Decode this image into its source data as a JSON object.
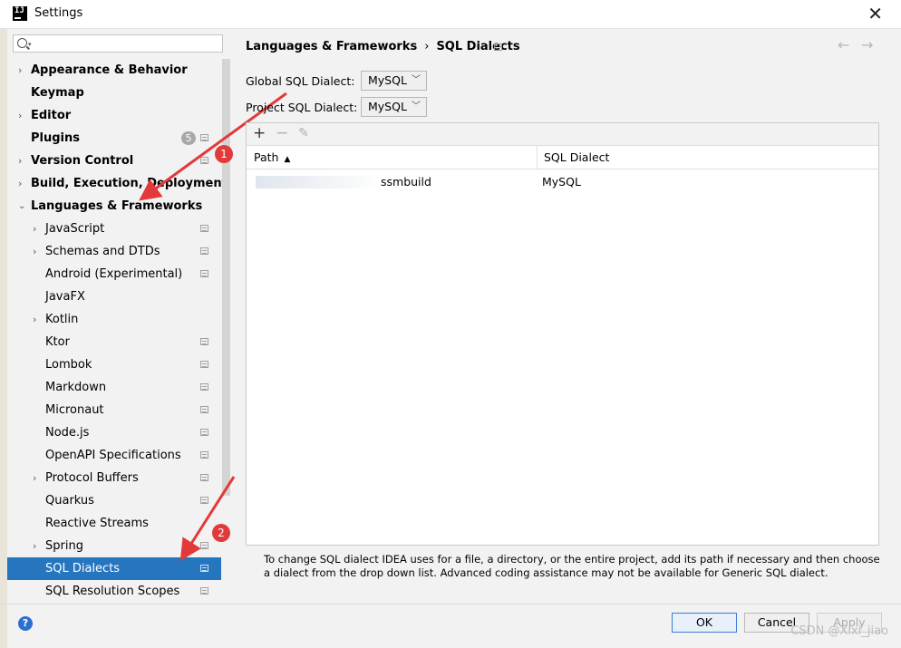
{
  "window": {
    "title": "Settings",
    "app_icon_text": "IJ",
    "close_glyph": "✕"
  },
  "search": {
    "value": "",
    "placeholder": ""
  },
  "tree": {
    "top_items": [
      {
        "label": "Appearance & Behavior",
        "expandable": true
      },
      {
        "label": "Keymap",
        "expandable": false
      },
      {
        "label": "Editor",
        "expandable": true
      },
      {
        "label": "Plugins",
        "expandable": false,
        "badge": "5"
      },
      {
        "label": "Version Control",
        "expandable": true
      },
      {
        "label": "Build, Execution, Deployment",
        "expandable": true
      },
      {
        "label": "Languages & Frameworks",
        "expanded": true
      }
    ],
    "sub_items": [
      {
        "label": "JavaScript",
        "expandable": true
      },
      {
        "label": "Schemas and DTDs",
        "expandable": true
      },
      {
        "label": "Android (Experimental)",
        "expandable": false
      },
      {
        "label": "JavaFX",
        "expandable": false
      },
      {
        "label": "Kotlin",
        "expandable": true
      },
      {
        "label": "Ktor",
        "expandable": false
      },
      {
        "label": "Lombok",
        "expandable": false
      },
      {
        "label": "Markdown",
        "expandable": false
      },
      {
        "label": "Micronaut",
        "expandable": false
      },
      {
        "label": "Node.js",
        "expandable": false
      },
      {
        "label": "OpenAPI Specifications",
        "expandable": false
      },
      {
        "label": "Protocol Buffers",
        "expandable": true
      },
      {
        "label": "Quarkus",
        "expandable": false
      },
      {
        "label": "Reactive Streams",
        "expandable": false
      },
      {
        "label": "Spring",
        "expandable": true
      },
      {
        "label": "SQL Dialects",
        "selected": true
      },
      {
        "label": "SQL Resolution Scopes",
        "expandable": false
      }
    ]
  },
  "annotations": {
    "marker1": "1",
    "marker2": "2",
    "color": "#e23a3a"
  },
  "breadcrumb": {
    "parent": "Languages & Frameworks",
    "separator": "›",
    "current": "SQL Dialects"
  },
  "nav": {
    "back": "←",
    "forward": "→"
  },
  "settings": {
    "global_label": "Global SQL Dialect:",
    "global_value": "MySQL",
    "project_label": "Project SQL Dialect:",
    "project_value": "MySQL"
  },
  "table": {
    "toolbar": {
      "add": "+",
      "remove": "−",
      "edit": "✎"
    },
    "columns": [
      "Path",
      "SQL Dialect"
    ],
    "rows": [
      {
        "path": "ssmbuild",
        "dialect": "MySQL"
      }
    ]
  },
  "description": "To change SQL dialect IDEA uses for a file, a directory, or the entire project, add its path if necessary and then choose a dialect from the drop down list. Advanced coding assistance may not be available for Generic SQL dialect.",
  "buttons": {
    "ok": "OK",
    "cancel": "Cancel",
    "apply": "Apply",
    "help": "?"
  },
  "watermark": "CSDN @Xixi_jiao",
  "colors": {
    "selection": "#2675bf",
    "accent": "#3d7ed6"
  }
}
